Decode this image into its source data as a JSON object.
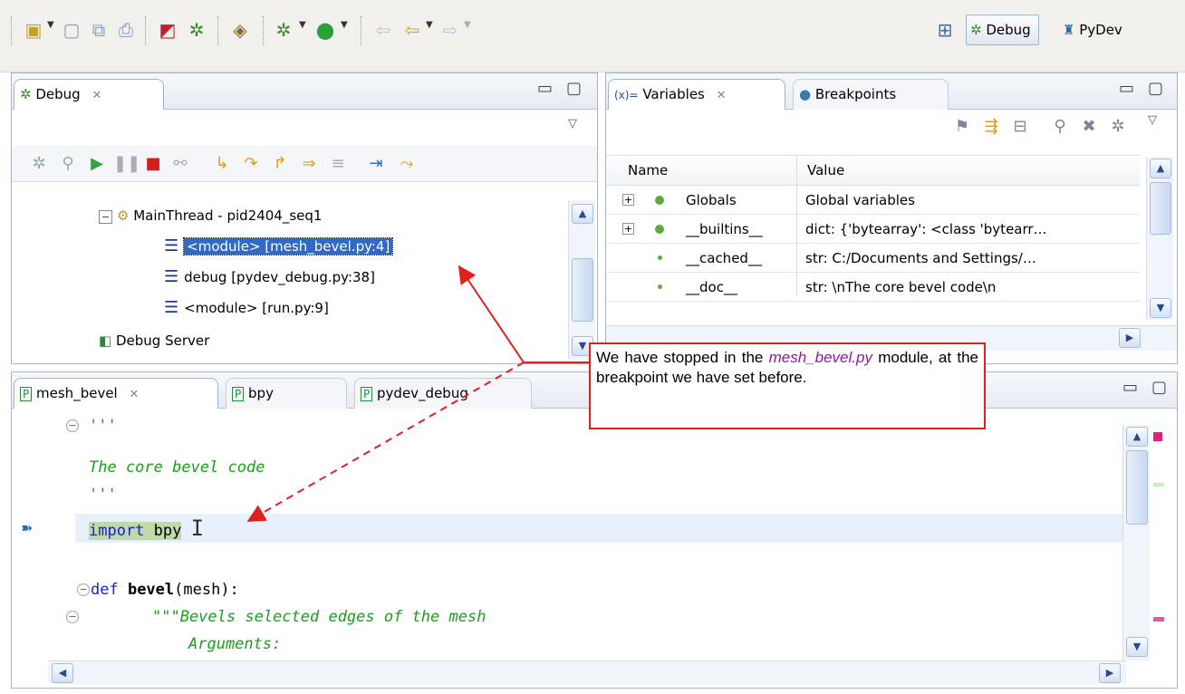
{
  "toolbar": {
    "perspectives": [
      {
        "label": "Debug",
        "icon": "debug-bug-icon",
        "active": true
      },
      {
        "label": "PyDev",
        "icon": "python-icon",
        "active": false
      }
    ]
  },
  "debug_view": {
    "tab_label": "Debug",
    "tree": {
      "thread": "MainThread - pid2404_seq1",
      "frames": [
        {
          "label": "<module> [mesh_bevel.py:4]",
          "selected": true
        },
        {
          "label": "debug [pydev_debug.py:38]",
          "selected": false
        },
        {
          "label": "<module> [run.py:9]",
          "selected": false
        }
      ],
      "server": "Debug Server"
    }
  },
  "variables_view": {
    "tabs": [
      {
        "label": "Variables",
        "prefix": "(x)=",
        "active": true
      },
      {
        "label": "Breakpoints",
        "active": false
      }
    ],
    "columns": [
      "Name",
      "Value"
    ],
    "rows": [
      {
        "name": "Globals",
        "value": "Global variables",
        "expandable": true
      },
      {
        "name": "__builtins__",
        "value": "dict: {'bytearray': <class 'bytearr…",
        "expandable": true
      },
      {
        "name": "__cached__",
        "value": "str: C:/Documents and Settings/…",
        "expandable": false
      },
      {
        "name": "__doc__",
        "value": "str: \\nThe core bevel code\\n",
        "expandable": false
      }
    ]
  },
  "editor": {
    "tabs": [
      {
        "label": "mesh_bevel",
        "active": true
      },
      {
        "label": "bpy",
        "active": false
      },
      {
        "label": "pydev_debug",
        "active": false
      }
    ],
    "code": {
      "l1": "'''",
      "l2": "The core bevel code",
      "l3": "'''",
      "l4_kw": "import",
      "l4_rest": " bpy",
      "l6_kw": "def ",
      "l6_name": "bevel",
      "l6_rest": "(mesh):",
      "l7": "\"\"\"Bevels selected edges of the mesh",
      "l8": "Arguments:"
    }
  },
  "callout": {
    "prefix": "We have stopped in the ",
    "emph": "mesh_bevel.py",
    "suffix": " module, at the breakpoint we have set before."
  },
  "colors": {
    "callout_border": "#e02020",
    "selection": "#316ac5",
    "comment_green": "#19a019",
    "keyword_blue": "#1a22c8"
  }
}
